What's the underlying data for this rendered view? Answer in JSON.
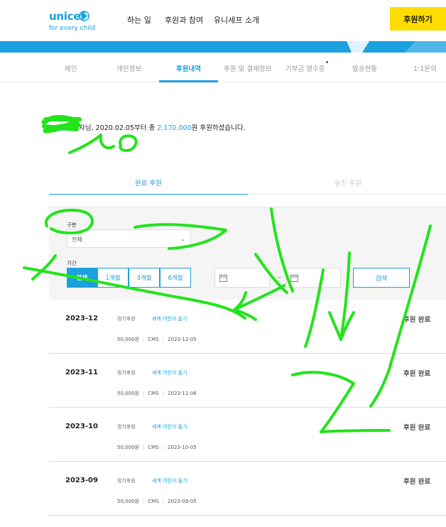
{
  "header": {
    "logo_word": "unicef",
    "logo_tagline": "for every child",
    "nav": [
      "하는 일",
      "후원과 참여",
      "유니세프 소개"
    ],
    "donate_label": "후원하기"
  },
  "tabs": [
    "메인",
    "개인정보",
    "후원내역",
    "후원 및 결제정보",
    "기부금 영수증",
    "발송현황",
    "1:1문의"
  ],
  "active_tab": "후원내역",
  "summary": {
    "name": "000님",
    "prefix": "후원자님,",
    "since": "2020.02.05부터 총 ",
    "amount": "2,170,000",
    "suffix": "원 후원하셨습니다."
  },
  "subtabs": {
    "completed": "완료 후원",
    "missed": "놓친 후원"
  },
  "filter": {
    "type_label": "구분",
    "type_value": "전체",
    "period_label": "기간",
    "periods": [
      "전체",
      "1개월",
      "3개월",
      "6개월"
    ],
    "range_sep": "~",
    "search_label": "검색"
  },
  "rows": [
    {
      "month": "2023-12",
      "type": "정기후원",
      "name": "세계 어린이 돕기",
      "amount": "50,000원",
      "method": "CMS",
      "date": "2023-12-05",
      "status": "후원 완료"
    },
    {
      "month": "2023-11",
      "type": "정기후원",
      "name": "세계 어린이 돕기",
      "amount": "50,000원",
      "method": "CMS",
      "date": "2023-11-06",
      "status": "후원 완료"
    },
    {
      "month": "2023-10",
      "type": "정기후원",
      "name": "세계 어린이 돕기",
      "amount": "50,000원",
      "method": "CMS",
      "date": "2023-10-05",
      "status": "후원 완료"
    },
    {
      "month": "2023-09",
      "type": "정기후원",
      "name": "세계 어린이 돕기",
      "amount": "50,000원",
      "method": "CMS",
      "date": "2023-09-05",
      "status": "후원 완료"
    }
  ],
  "colors": {
    "brand_blue": "#1ca0de",
    "donate_yellow": "#fedd00",
    "scribble_green": "#22e41b"
  }
}
